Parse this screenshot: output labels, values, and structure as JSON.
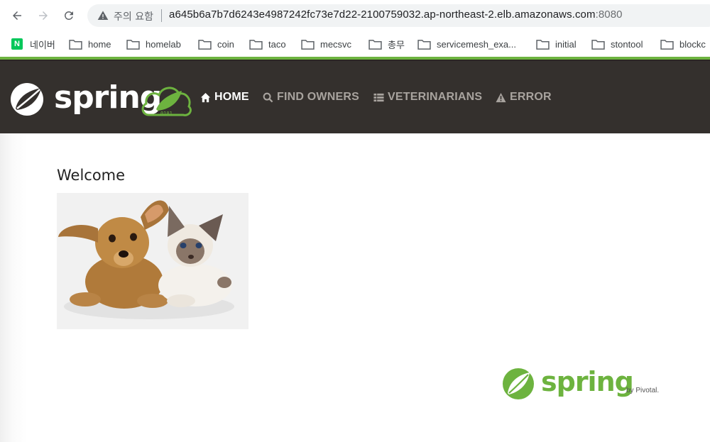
{
  "browser": {
    "security_label": "주의 요함",
    "url_host": "a645b6a7b7d6243e4987242fc73e7d22-2100759032.ap-northeast-2.elb.amazonaws.com",
    "url_port": ":8080",
    "icons": {
      "back": "arrow-left-icon",
      "forward": "arrow-right-icon",
      "reload": "reload-icon",
      "warning": "warning-triangle-icon"
    }
  },
  "bookmarks": [
    {
      "label": "네이버",
      "icon": "naver-icon"
    },
    {
      "label": "home",
      "icon": "folder-icon"
    },
    {
      "label": "homelab",
      "icon": "folder-icon"
    },
    {
      "label": "coin",
      "icon": "folder-icon"
    },
    {
      "label": "taco",
      "icon": "folder-icon"
    },
    {
      "label": "mecsvc",
      "icon": "folder-icon"
    },
    {
      "label": "총무",
      "icon": "folder-icon"
    },
    {
      "label": "servicemesh_exa...",
      "icon": "folder-icon"
    },
    {
      "label": "initial",
      "icon": "folder-icon"
    },
    {
      "label": "stontool",
      "icon": "folder-icon"
    },
    {
      "label": "blockc",
      "icon": "folder-icon"
    }
  ],
  "navbar": {
    "logo_text": "spring",
    "items": [
      {
        "label": "HOME",
        "icon": "home-icon",
        "active": true
      },
      {
        "label": "FIND OWNERS",
        "icon": "search-icon",
        "active": false
      },
      {
        "label": "VETERINARIANS",
        "icon": "list-icon",
        "active": false
      },
      {
        "label": "ERROR",
        "icon": "warning-icon",
        "active": false
      }
    ]
  },
  "main": {
    "heading": "Welcome"
  },
  "footer": {
    "logo_text": "spring",
    "by_text": "by Pivotal."
  },
  "colors": {
    "spring_green": "#6db33f",
    "navbar_bg": "#34302d",
    "nav_inactive": "#a8a39e"
  }
}
